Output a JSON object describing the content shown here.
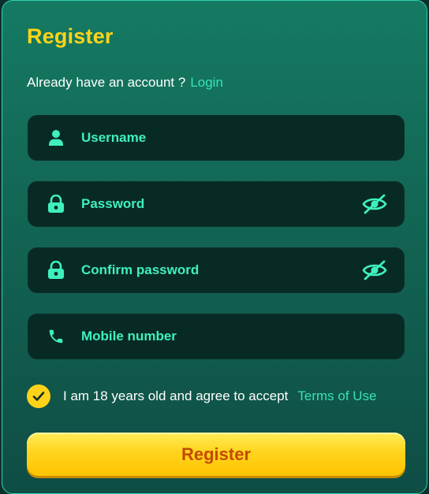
{
  "title": "Register",
  "account": {
    "prompt": "Already have an account ?",
    "login_label": "Login"
  },
  "fields": {
    "username": {
      "placeholder": "Username",
      "icon": "user-icon"
    },
    "password": {
      "placeholder": "Password",
      "icon": "lock-icon",
      "toggle_icon": "eye-off-icon"
    },
    "confirm_password": {
      "placeholder": "Confirm password",
      "icon": "lock-icon",
      "toggle_icon": "eye-off-icon"
    },
    "mobile": {
      "placeholder": "Mobile number",
      "icon": "phone-icon"
    }
  },
  "agreement": {
    "checked": true,
    "text": "I am 18 years old and agree to accept",
    "terms_label": "Terms of Use"
  },
  "submit_label": "Register",
  "colors": {
    "accent_yellow": "#ffd418",
    "accent_green": "#37e3b3",
    "button_text": "#c34a00",
    "field_bg": "#082a25"
  }
}
